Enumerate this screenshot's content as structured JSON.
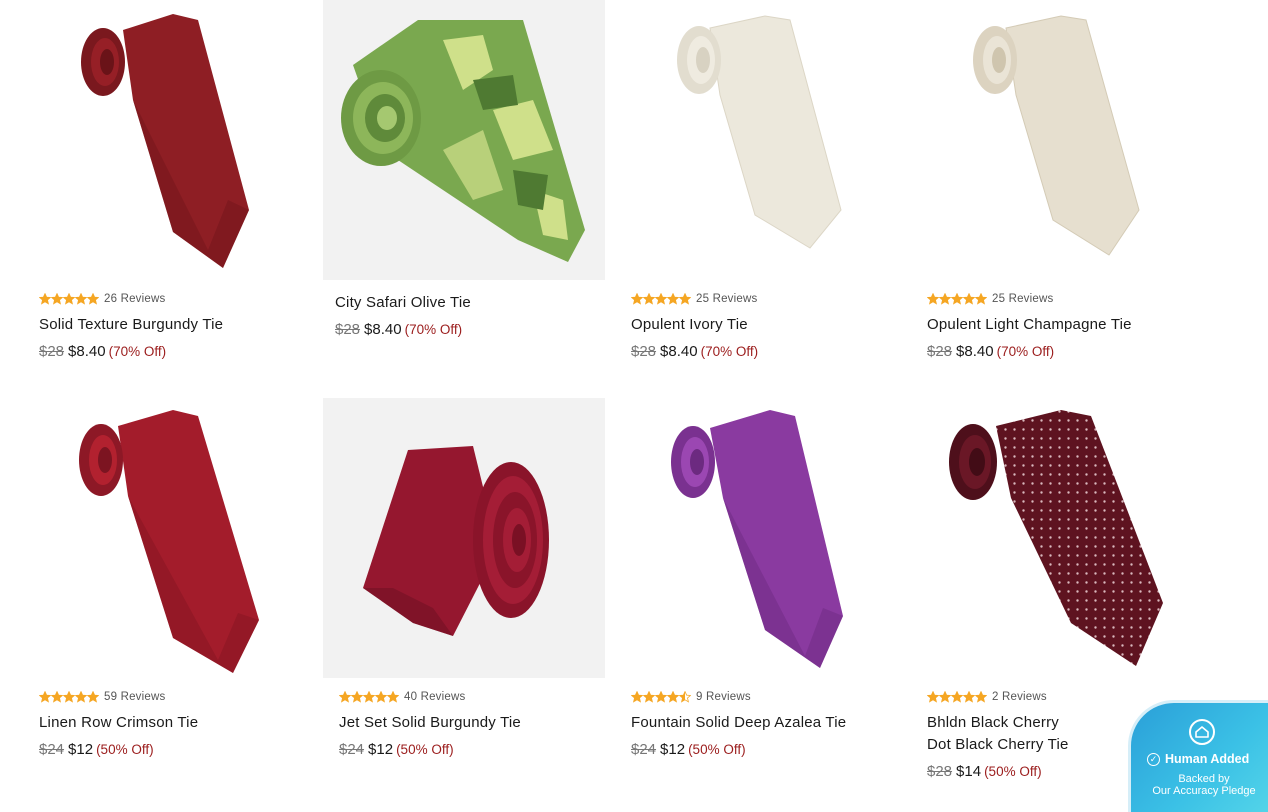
{
  "colors": {
    "star": "#f5a623",
    "discount": "#9b1c1c",
    "badge_accent": "#3bc1e6"
  },
  "products": [
    {
      "name": "Solid Texture Burgundy Tie",
      "reviews": "26 Reviews",
      "rating": 5,
      "original_price": "$28",
      "sale_price": "$8.40",
      "discount": "(70% Off)",
      "image_icon": "tie-burgundy-rolled",
      "tie_color": "#8e1e24"
    },
    {
      "name": "City Safari Olive Tie",
      "reviews": "",
      "rating": 0,
      "original_price": "$28",
      "sale_price": "$8.40",
      "discount": "(70% Off)",
      "image_icon": "tie-camo-rolled",
      "tie_color": "#6f9f48"
    },
    {
      "name": "Opulent Ivory Tie",
      "reviews": "25 Reviews",
      "rating": 5,
      "original_price": "$28",
      "sale_price": "$8.40",
      "discount": "(70% Off)",
      "image_icon": "tie-ivory-rolled",
      "tie_color": "#ebe7da"
    },
    {
      "name": "Opulent Light Champagne Tie",
      "reviews": "25 Reviews",
      "rating": 5,
      "original_price": "$28",
      "sale_price": "$8.40",
      "discount": "(70% Off)",
      "image_icon": "tie-champagne-rolled",
      "tie_color": "#e4dccb"
    },
    {
      "name": "Linen Row Crimson Tie",
      "reviews": "59 Reviews",
      "rating": 5,
      "original_price": "$24",
      "sale_price": "$12",
      "discount": "(50% Off)",
      "image_icon": "tie-crimson-rolled",
      "tie_color": "#a31c2b"
    },
    {
      "name": "Jet Set Solid Burgundy Tie",
      "reviews": "40 Reviews",
      "rating": 5,
      "original_price": "$24",
      "sale_price": "$12",
      "discount": "(50% Off)",
      "image_icon": "tie-burgundy-coiled",
      "tie_color": "#95172f"
    },
    {
      "name": "Fountain Solid Deep Azalea Tie",
      "reviews": "9 Reviews",
      "rating": 4.5,
      "original_price": "$24",
      "sale_price": "$12",
      "discount": "(50% Off)",
      "image_icon": "tie-azalea-rolled",
      "tie_color": "#8a3aa0"
    },
    {
      "name": "Bhldn Black Cherry Dot Black Cherry Tie",
      "reviews": "2 Reviews",
      "rating": 5,
      "original_price": "$28",
      "sale_price": "$14",
      "discount": "(50% Off)",
      "image_icon": "tie-black-cherry-dot-rolled",
      "tie_color": "#5e1320"
    }
  ],
  "badge": {
    "icon": "home-shield-icon",
    "title": "Human Added",
    "line1": "Backed by",
    "line2": "Our Accuracy Pledge"
  }
}
